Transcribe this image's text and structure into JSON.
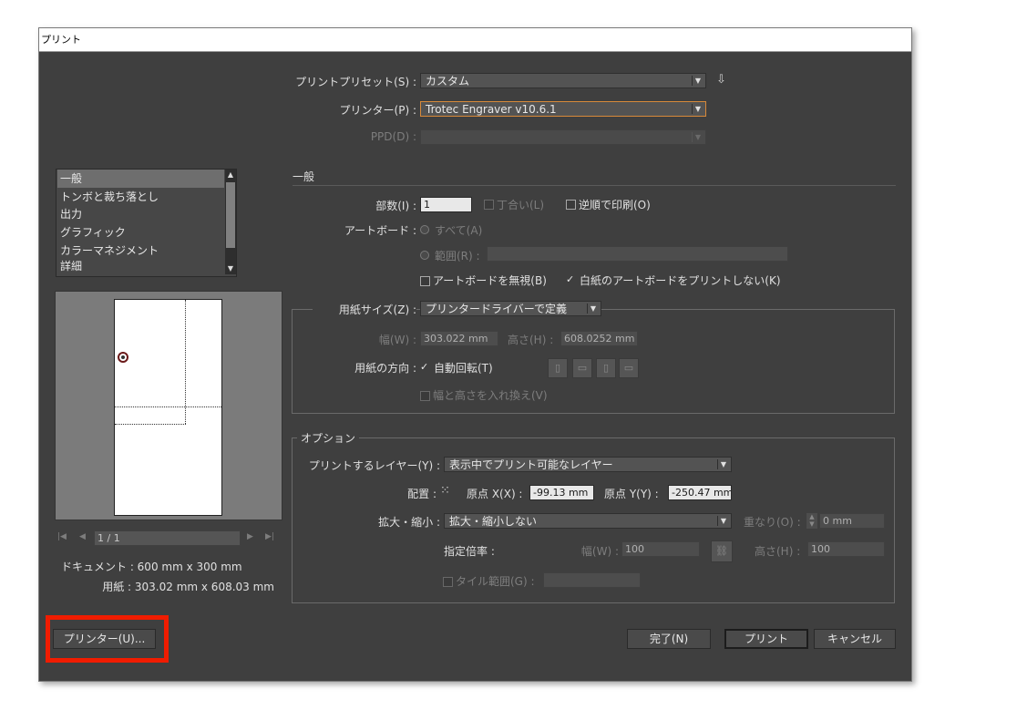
{
  "window": {
    "title": "プリント"
  },
  "header": {
    "preset_label": "プリントプリセット(S) :",
    "preset_value": "カスタム",
    "printer_label": "プリンター(P) :",
    "printer_value": "Trotec Engraver v10.6.1",
    "ppd_label": "PPD(D) :",
    "ppd_value": ""
  },
  "sidebar": {
    "items": [
      {
        "label": "一般",
        "selected": true
      },
      {
        "label": "トンボと裁ち落とし"
      },
      {
        "label": "出力"
      },
      {
        "label": "グラフィック"
      },
      {
        "label": "カラーマネジメント"
      },
      {
        "label": "詳細"
      }
    ]
  },
  "preview": {
    "page_indicator": "1 / 1",
    "document_info": "ドキュメント : 600 mm x 300 mm",
    "paper_info": "用紙 : 303.02 mm x 608.03 mm"
  },
  "general": {
    "section_title": "一般",
    "copies_label": "部数(I) :",
    "copies_value": "1",
    "collate_label": "丁合い(L)",
    "reverse_label": "逆順で印刷(O)",
    "artboard_label": "アートボード :",
    "all_label": "すべて(A)",
    "range_label": "範囲(R) :",
    "ignore_artboards_label": "アートボードを無視(B)",
    "skip_blank_label": "白紙のアートボードをプリントしない(K)"
  },
  "paper": {
    "size_label": "用紙サイズ(Z) :",
    "size_value": "プリンタードライバーで定義",
    "width_label": "幅(W) :",
    "width_value": "303.022 mm",
    "height_label": "高さ(H) :",
    "height_value": "608.0252 mm",
    "orientation_label": "用紙の方向 :",
    "auto_rotate_label": "自動回転(T)",
    "swap_label": "幅と高さを入れ換え(V)"
  },
  "options": {
    "section_title": "オプション",
    "layers_label": "プリントするレイヤー(Y) :",
    "layers_value": "表示中でプリント可能なレイヤー",
    "placement_label": "配置 :",
    "origin_x_label": "原点 X(X) :",
    "origin_x_value": "-99.13 mm",
    "origin_y_label": "原点 Y(Y) :",
    "origin_y_value": "-250.47 mm",
    "scaling_label": "拡大・縮小 :",
    "scaling_value": "拡大・縮小しない",
    "overlap_label": "重なり(O) :",
    "overlap_value": "0 mm",
    "scale_label": "指定倍率 :",
    "scale_w_label": "幅(W) :",
    "scale_w_value": "100",
    "scale_h_label": "高さ(H) :",
    "scale_h_value": "100",
    "tile_label": "タイル範囲(G) :"
  },
  "footer": {
    "printer_button": "プリンター(U)...",
    "done_button": "完了(N)",
    "print_button": "プリント",
    "cancel_button": "キャンセル"
  },
  "colors": {
    "dialog_bg": "#3f3f3f",
    "highlight": "#f01c00",
    "focus": "#d7893a"
  }
}
